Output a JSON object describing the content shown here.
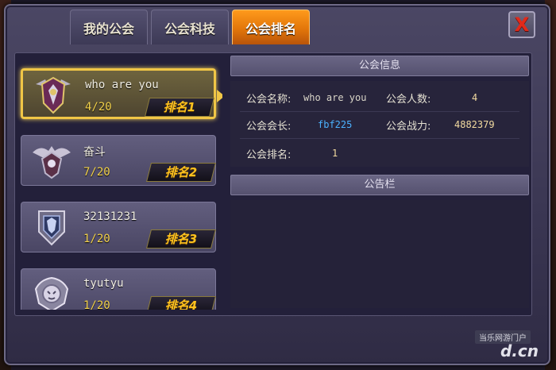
{
  "tabs": [
    {
      "label": "我的公会",
      "active": false
    },
    {
      "label": "公会科技",
      "active": false
    },
    {
      "label": "公会排名",
      "active": true
    }
  ],
  "close_label": "X",
  "guild_list": [
    {
      "name": "who are you",
      "members": "4/20",
      "rank": "排名1",
      "selected": true,
      "emblem": "winged-shield-emblem-icon"
    },
    {
      "name": "奋斗",
      "members": "7/20",
      "rank": "排名2",
      "selected": false,
      "emblem": "eagle-crest-emblem-icon"
    },
    {
      "name": "32131231",
      "members": "1/20",
      "rank": "排名3",
      "selected": false,
      "emblem": "wolf-shield-emblem-icon"
    },
    {
      "name": "tyutyu",
      "members": "1/20",
      "rank": "排名4",
      "selected": false,
      "emblem": "tiger-crest-emblem-icon"
    }
  ],
  "info": {
    "header": "公会信息",
    "name_label": "公会名称:",
    "name_value": "who are you",
    "count_label": "公会人数:",
    "count_value": "4",
    "leader_label": "公会会长:",
    "leader_value": "fbf225",
    "power_label": "公会战力:",
    "power_value": "4882379",
    "rank_label": "公会排名:",
    "rank_value": "1"
  },
  "notice": {
    "header": "公告栏"
  },
  "watermark": {
    "site_cn": "当乐网游门户",
    "site_domain": "d.cn"
  },
  "colors": {
    "active_tab": "#f08a12",
    "rank_text": "#ffc21f",
    "leader_link": "#4bb2ff",
    "selected_border": "#f0c646"
  }
}
